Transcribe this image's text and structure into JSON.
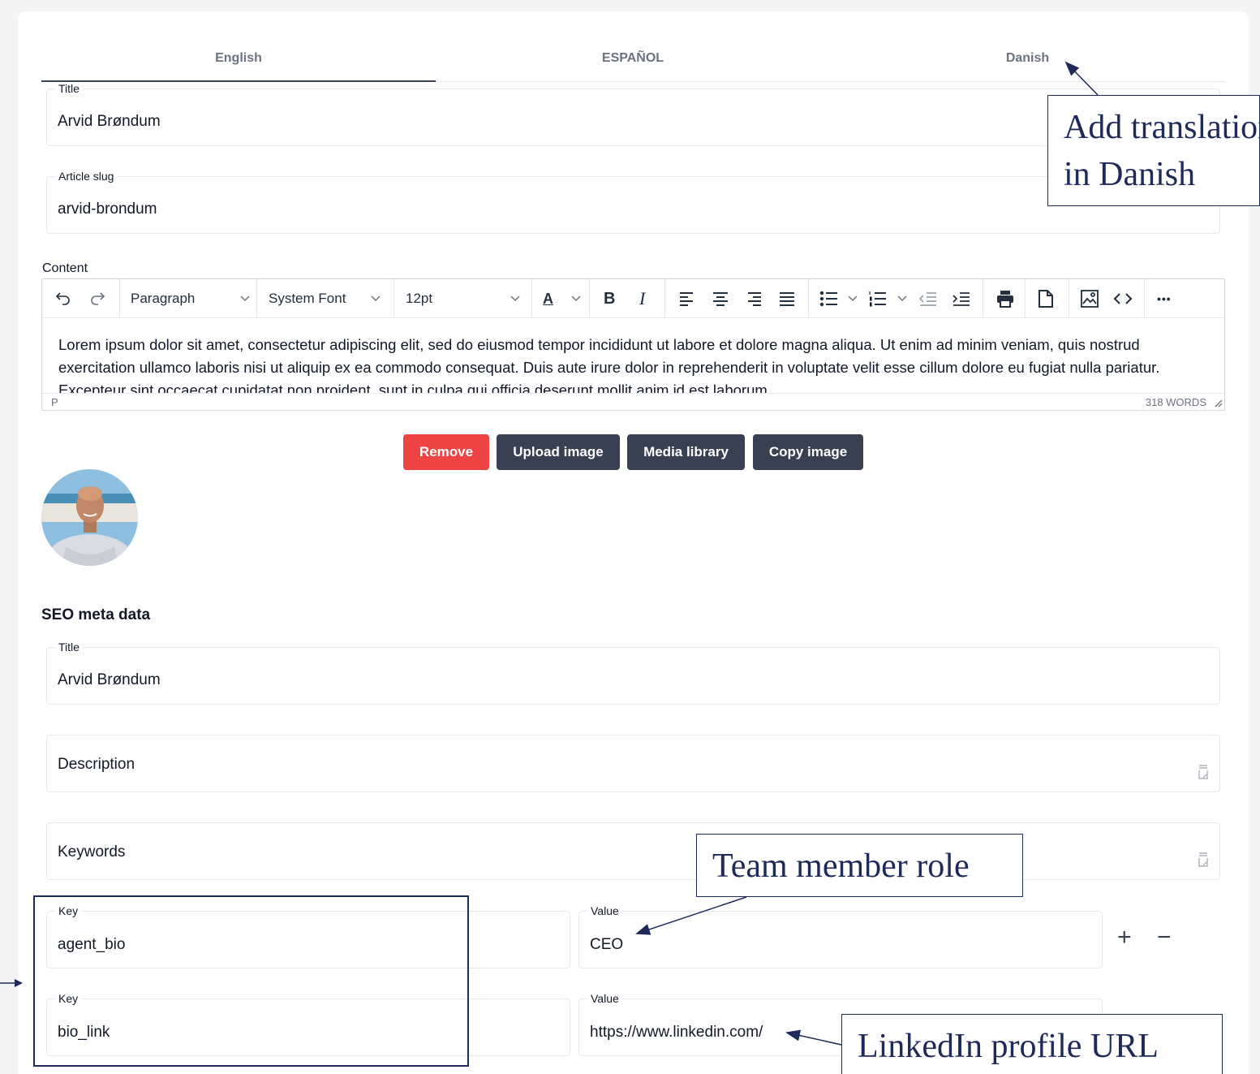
{
  "tabs": [
    {
      "label": "English"
    },
    {
      "label": "ESPAÑOL"
    },
    {
      "label": "Danish"
    }
  ],
  "article": {
    "title_label": "Title",
    "title_value": "Arvid Brøndum",
    "slug_label": "Article slug",
    "slug_value": "arvid-brondum"
  },
  "editor": {
    "label": "Content",
    "block_format": "Paragraph",
    "font_family": "System Font",
    "font_size": "12pt",
    "color_button": "A",
    "bold": "B",
    "italic": "I",
    "more": "•••",
    "body": "Lorem ipsum dolor sit amet, consectetur adipiscing elit, sed do eiusmod tempor incididunt ut labore et dolore magna aliqua. Ut enim ad minim veniam, quis nostrud exercitation ullamco laboris nisi ut aliquip ex ea commodo consequat. Duis aute irure dolor in reprehenderit in voluptate velit esse cillum dolore eu fugiat nulla pariatur. Excepteur sint occaecat cupidatat non proident, sunt in culpa qui officia deserunt mollit anim id est laborum.",
    "path": "P",
    "word_count": "318 WORDS"
  },
  "image_buttons": {
    "remove": "Remove",
    "upload": "Upload image",
    "media": "Media library",
    "copy": "Copy image"
  },
  "seo": {
    "heading": "SEO meta data",
    "title_label": "Title",
    "title_value": "Arvid Brøndum",
    "description_placeholder": "Description",
    "keywords_placeholder": "Keywords"
  },
  "meta_rows": [
    {
      "key_label": "Key",
      "key": "agent_bio",
      "value_label": "Value",
      "value": "CEO"
    },
    {
      "key_label": "Key",
      "key": "bio_link",
      "value_label": "Value",
      "value": "https://www.linkedin.com/"
    }
  ],
  "row_actions": {
    "add": "+",
    "remove": "−"
  },
  "annotations": {
    "translation_line1": "Add translation",
    "translation_line2": "in Danish",
    "role": "Team member role",
    "linkedin": "LinkedIn profile URL"
  },
  "colors": {
    "remove_button": "#ef4444",
    "dark_button": "#374151",
    "annotation": "#1e2a5a"
  }
}
